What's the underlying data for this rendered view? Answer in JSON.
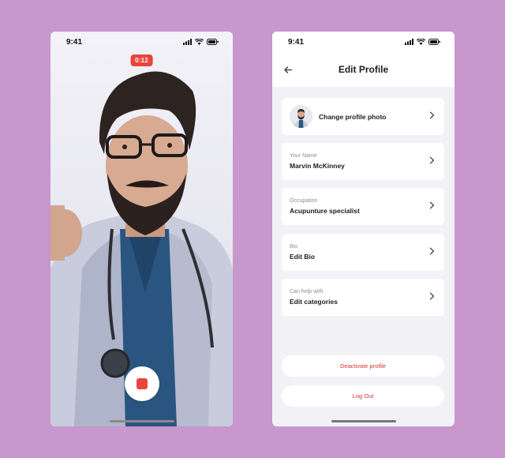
{
  "camera_screen": {
    "status_time": "9:41",
    "recording_timer": "0:12"
  },
  "profile_screen": {
    "status_time": "9:41",
    "title": "Edit Profile",
    "change_photo_label": "Change profile photo",
    "fields": [
      {
        "label": "Your Name",
        "value": "Marvin McKinney"
      },
      {
        "label": "Occupation",
        "value": "Acupunture specialist"
      },
      {
        "label": "Bio",
        "value": "Edit Bio"
      },
      {
        "label": "Can help with",
        "value": "Edit categories"
      }
    ],
    "deactivate_label": "Deactivate profile",
    "logout_label": "Log Out"
  },
  "colors": {
    "background": "#c797cd",
    "accent_red": "#e8463e",
    "danger_text": "#d8352f"
  },
  "icons": [
    "signal-icon",
    "wifi-icon",
    "battery-icon",
    "back-arrow-icon",
    "chevron-right-icon",
    "stop-icon"
  ]
}
